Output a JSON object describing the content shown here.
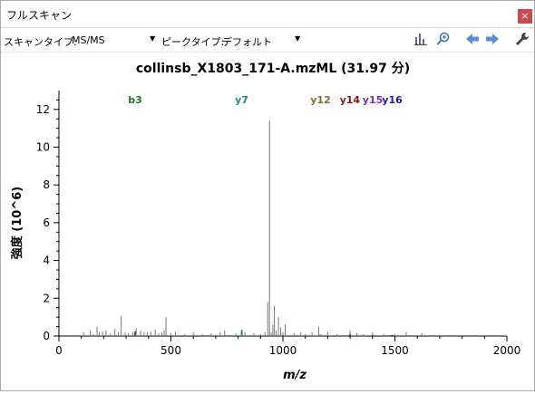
{
  "window": {
    "title": "フルスキャン",
    "close_glyph": "×"
  },
  "toolbar": {
    "scan_type_label": "スキャンタイプ:",
    "scan_type_value": "MS/MS",
    "peak_type_label": "ピークタイプ:",
    "peak_type_value": "デフォルト",
    "icons": [
      "spectrum-bars-icon",
      "zoom-in-icon",
      "arrow-left-icon",
      "arrow-right-icon",
      "wrench-icon"
    ]
  },
  "chart_data": {
    "type": "bar",
    "title": "collinsb_X1803_171-A.mzML (31.97 分)",
    "xlabel": "m/z",
    "ylabel": "強度 (10^6)",
    "xlim": [
      0,
      2000
    ],
    "ylim": [
      0,
      12.9
    ],
    "x_ticks": [
      "0",
      "500",
      "1000",
      "1500",
      "2000"
    ],
    "y_ticks": [
      "0",
      "2",
      "4",
      "6",
      "8",
      "10",
      "12"
    ],
    "grid": false,
    "peaks": {
      "mz": [
        110,
        140,
        152,
        170,
        180,
        195,
        210,
        230,
        250,
        265,
        278,
        295,
        310,
        330,
        345,
        365,
        380,
        395,
        410,
        430,
        445,
        460,
        470,
        478,
        500,
        520,
        560,
        600,
        640,
        680,
        720,
        740,
        790,
        830,
        870,
        900,
        920,
        932,
        940,
        948,
        955,
        962,
        970,
        980,
        990,
        1000,
        1010,
        1050,
        1080,
        1100,
        1130,
        1160,
        1200,
        1240,
        1300,
        1330,
        1360,
        1400,
        1450,
        1500,
        1550,
        1620
      ],
      "intensity": [
        0.2,
        0.3,
        0.1,
        0.5,
        0.2,
        0.25,
        0.3,
        0.15,
        0.4,
        0.2,
        1.05,
        0.2,
        0.15,
        0.2,
        0.4,
        0.3,
        0.2,
        0.2,
        0.25,
        0.35,
        0.15,
        0.2,
        0.3,
        1.0,
        0.15,
        0.2,
        0.1,
        0.2,
        0.1,
        0.15,
        0.2,
        0.3,
        0.15,
        0.2,
        0.15,
        0.1,
        0.2,
        1.8,
        11.4,
        0.2,
        0.6,
        1.6,
        0.3,
        1.0,
        0.45,
        0.2,
        0.6,
        0.15,
        0.2,
        0.1,
        0.2,
        0.5,
        0.2,
        0.1,
        0.3,
        0.15,
        0.1,
        0.2,
        0.1,
        0.1,
        0.2,
        0.15
      ]
    },
    "annotated_peaks": [
      {
        "label": "b3",
        "mz": 340,
        "intensity": 0.25,
        "color": "#1f7a1f"
      },
      {
        "label": "y7",
        "mz": 816,
        "intensity": 0.32,
        "color": "#1a8a8a"
      },
      {
        "label": "y12",
        "mz": 1168,
        "intensity": 0.08,
        "color": "#8a6a2a"
      },
      {
        "label": "y14",
        "mz": 1299,
        "intensity": 0.08,
        "color": "#8b1a1a"
      },
      {
        "label": "y15",
        "mz": 1401,
        "intensity": 0.06,
        "color": "#7b2fa8"
      },
      {
        "label": "y16",
        "mz": 1488,
        "intensity": 0.06,
        "color": "#1a1ab0"
      }
    ]
  }
}
